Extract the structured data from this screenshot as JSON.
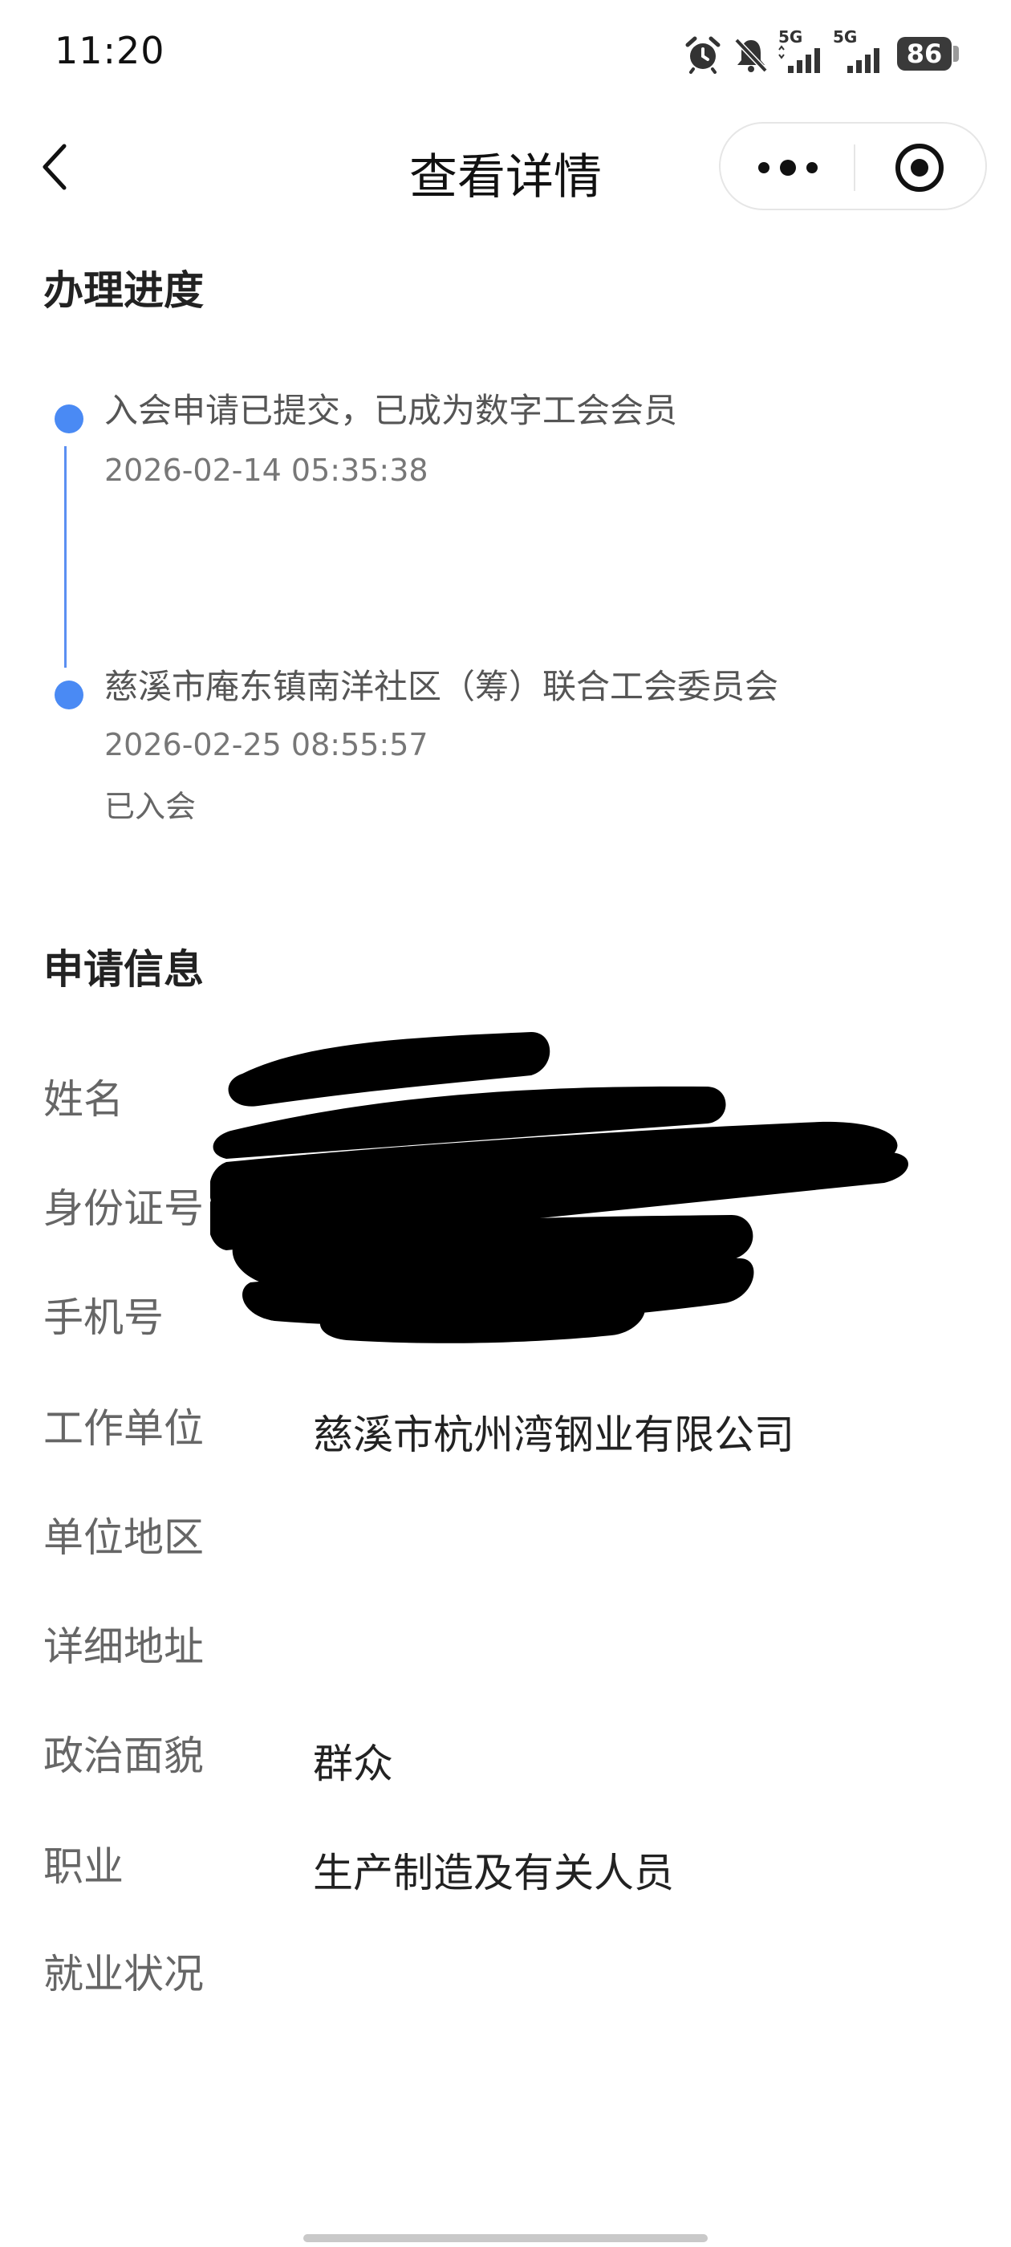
{
  "status_bar": {
    "time": "11:20",
    "net_label_1": "5G",
    "net_label_2": "5G",
    "battery": "86",
    "icons": [
      "alarm-icon",
      "mute-bell-icon",
      "signal-5g-icon",
      "signal-5g-icon",
      "battery-icon"
    ]
  },
  "nav": {
    "title": "查看详情",
    "back_icon": "chevron-left-icon",
    "more_icon": "more-dots-icon",
    "close_icon": "target-close-icon"
  },
  "progress": {
    "title": "办理进度",
    "steps": [
      {
        "text": "入会申请已提交，已成为数字工会会员",
        "date": "2026-02-14 05:35:38",
        "status": ""
      },
      {
        "text": "慈溪市庵东镇南洋社区（筹）联合工会委员会",
        "date": "2026-02-25 08:55:57",
        "status": "已入会"
      }
    ],
    "accent_color": "#4a8af4"
  },
  "application": {
    "title": "申请信息",
    "rows": [
      {
        "label": "姓名",
        "value": ""
      },
      {
        "label": "身份证号",
        "value": ""
      },
      {
        "label": "手机号",
        "value": ""
      },
      {
        "label": "工作单位",
        "value": "慈溪市杭州湾钢业有限公司"
      },
      {
        "label": "单位地区",
        "value": ""
      },
      {
        "label": "详细地址",
        "value": ""
      },
      {
        "label": "政治面貌",
        "value": "群众"
      },
      {
        "label": "职业",
        "value": "生产制造及有关人员"
      },
      {
        "label": "就业状况",
        "value": ""
      }
    ]
  }
}
